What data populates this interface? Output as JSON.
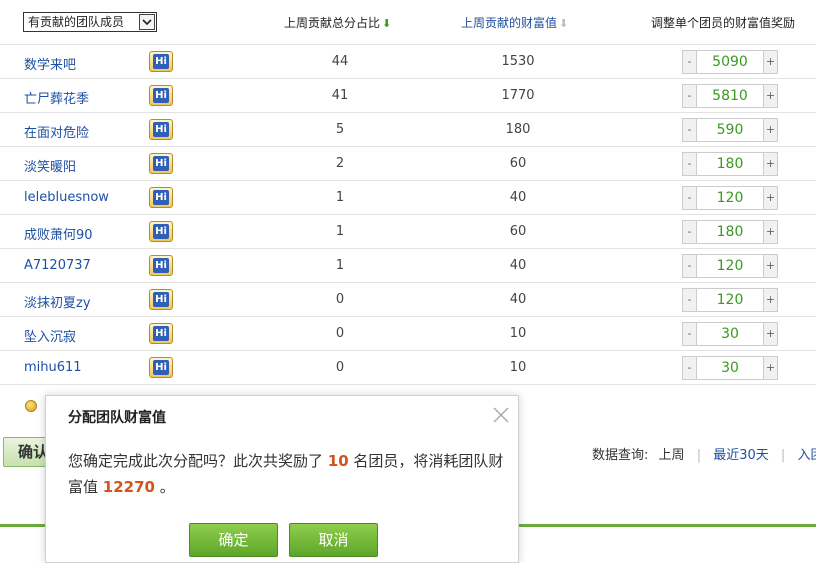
{
  "header": {
    "filter_label": "有贡献的团队成员",
    "col_pct": "上周贡献总分占比",
    "col_pct_arrow": "⬇",
    "col_wealth": "上周贡献的财富值",
    "col_wealth_arrow": "⬇",
    "col_adjust": "调整单个团员的财富值奖励"
  },
  "icons": {
    "member_badge": "hi-badge-icon",
    "coins": "coins-icon",
    "close": "close-icon"
  },
  "members": [
    {
      "name": "数学来吧",
      "pct": "44",
      "wealth": "1530",
      "reward": "5090"
    },
    {
      "name": "亡尸葬花季",
      "pct": "41",
      "wealth": "1770",
      "reward": "5810"
    },
    {
      "name": "在面对危险",
      "pct": "5",
      "wealth": "180",
      "reward": "590"
    },
    {
      "name": "淡笑暖阳",
      "pct": "2",
      "wealth": "60",
      "reward": "180"
    },
    {
      "name": "lelebluesnow",
      "pct": "1",
      "wealth": "40",
      "reward": "120"
    },
    {
      "name": "成败萧何90",
      "pct": "1",
      "wealth": "60",
      "reward": "180"
    },
    {
      "name": "A7120737",
      "pct": "1",
      "wealth": "40",
      "reward": "120"
    },
    {
      "name": "淡抹初夏zy",
      "pct": "0",
      "wealth": "40",
      "reward": "120"
    },
    {
      "name": "坠入沉寂",
      "pct": "0",
      "wealth": "10",
      "reward": "30"
    },
    {
      "name": "mihu611",
      "pct": "0",
      "wealth": "10",
      "reward": "30"
    }
  ],
  "stepper": {
    "minus": "-",
    "plus": "+"
  },
  "main_confirm_label": "确认",
  "query": {
    "label": "数据查询:",
    "last_week": "上周",
    "last_30": "最近30天",
    "since_join": "入团以来"
  },
  "dialog": {
    "title": "分配团队财富值",
    "msg_part1": "您确定完成此次分配吗？此次共奖励了 ",
    "member_count": "10",
    "msg_part2": " 名团员，将消耗团队财富值 ",
    "total": "12270",
    "msg_part3": " 。",
    "ok_label": "确定",
    "cancel_label": "取消"
  },
  "colors": {
    "accent_green": "#5da62a",
    "link_blue": "#1e50a2",
    "highlight_orange": "#d2531c",
    "value_green": "#3a9a1e"
  }
}
